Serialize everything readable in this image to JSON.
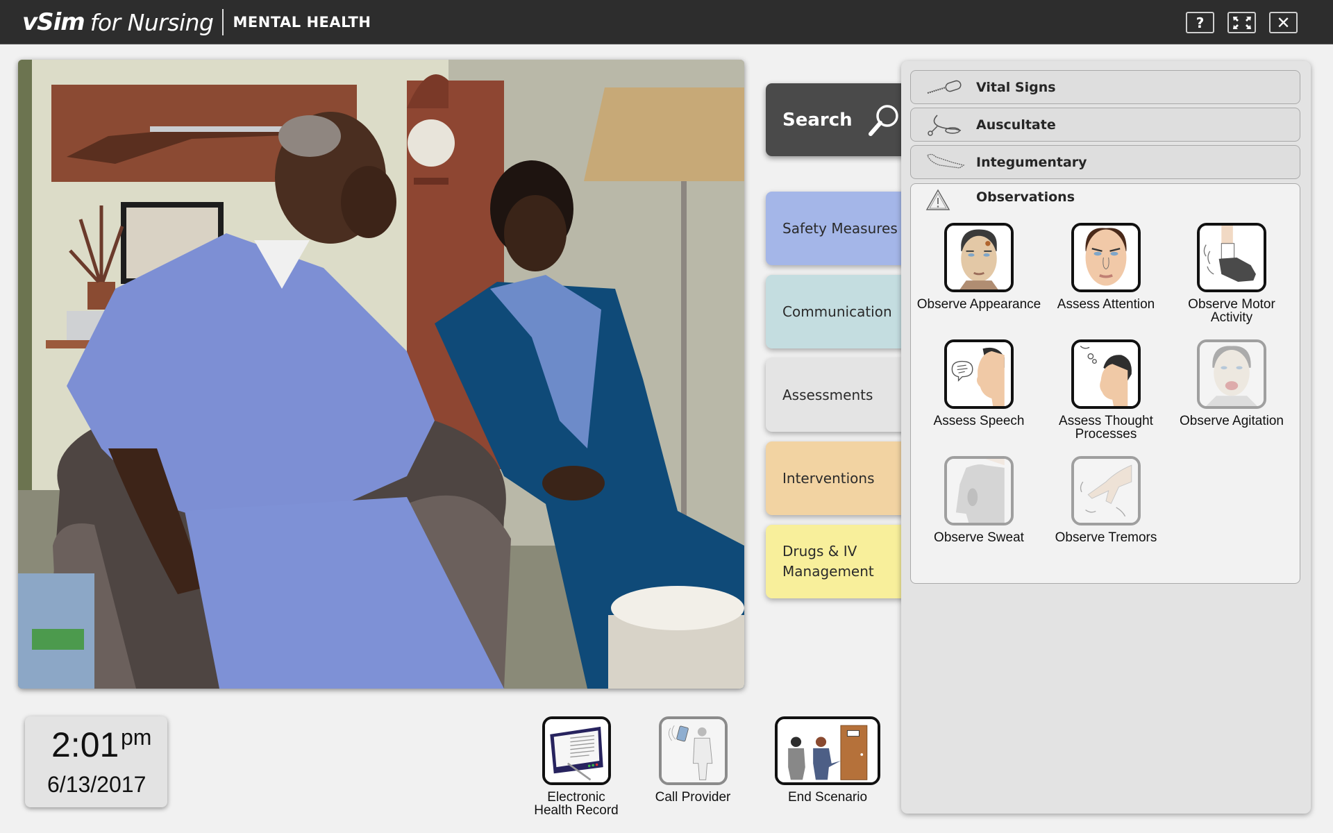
{
  "header": {
    "brand_vsim": "vSim",
    "brand_for": "for Nursing",
    "subtitle": "MENTAL HEALTH",
    "buttons": [
      {
        "label": "?",
        "icon": "help-icon"
      },
      {
        "label": "",
        "icon": "fullscreen-icon"
      },
      {
        "label": "✕",
        "icon": "close-icon"
      }
    ]
  },
  "scene": {
    "description": "Elderly patient in plaid pajamas seated in armchair with hand covering face; woman in blue dress with scarf kneeling beside him in a living room with mounted rifle, grandfather clock and floor lamp"
  },
  "search": {
    "label": "Search",
    "icon": "search-icon"
  },
  "categories": [
    {
      "label": "Safety Measures",
      "color": "#a4b6e8"
    },
    {
      "label": "Communication",
      "color": "#c4dde0"
    },
    {
      "label": "Assessments",
      "color": "#e4e4e4",
      "active": true
    },
    {
      "label": "Interventions",
      "color": "#f2d3a2"
    },
    {
      "label": "Drugs & IV Management",
      "color": "#f8ef9b"
    }
  ],
  "panel": {
    "sub_items": [
      {
        "label": "Vital Signs",
        "icon": "thermometer-icon"
      },
      {
        "label": "Auscultate",
        "icon": "stethoscope-icon"
      },
      {
        "label": "Integumentary",
        "icon": "body-outline-icon"
      }
    ],
    "observations": {
      "label": "Observations",
      "icon": "warning-triangle-icon",
      "items": [
        {
          "label": "Observe Appearance",
          "icon": "appearance-face-icon",
          "enabled": true
        },
        {
          "label": "Assess Attention",
          "icon": "attention-face-icon",
          "enabled": true
        },
        {
          "label": "Observe Motor Activity",
          "icon": "shoe-motion-icon",
          "enabled": true
        },
        {
          "label": "Assess Speech",
          "icon": "speech-profile-icon",
          "enabled": true
        },
        {
          "label": "Assess Thought Processes",
          "icon": "thought-profile-icon",
          "enabled": true
        },
        {
          "label": "Observe Agitation",
          "icon": "agitated-face-icon",
          "enabled": false
        },
        {
          "label": "Observe Sweat",
          "icon": "sweat-shirt-icon",
          "enabled": false
        },
        {
          "label": "Observe Tremors",
          "icon": "trembling-hand-icon",
          "enabled": false
        }
      ]
    }
  },
  "clock": {
    "time": "2:01",
    "ampm": "pm",
    "date": "6/13/2017"
  },
  "actions": [
    {
      "label": "Electronic Health Record",
      "icon": "tablet-record-icon",
      "enabled": true
    },
    {
      "label": "Call Provider",
      "icon": "phone-doctor-icon",
      "enabled": false
    },
    {
      "label": "End Scenario",
      "icon": "exit-door-icon",
      "enabled": true
    }
  ]
}
